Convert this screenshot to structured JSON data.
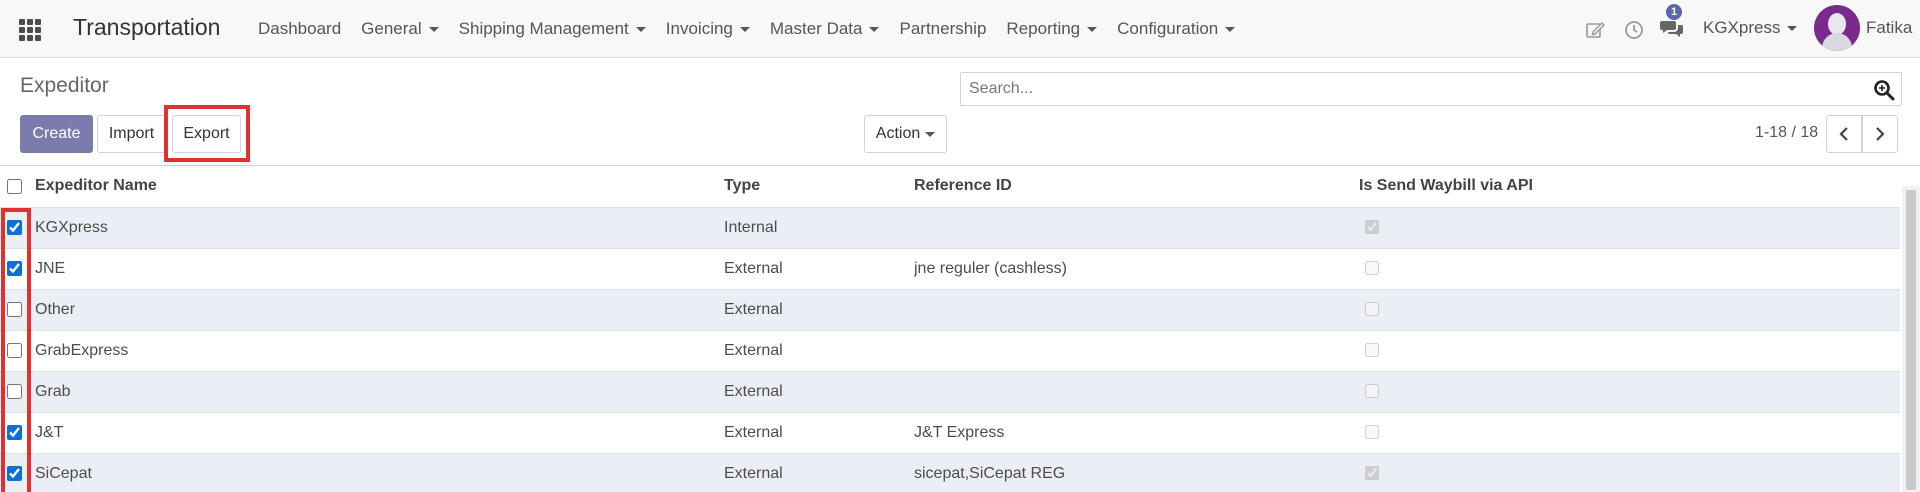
{
  "navbar": {
    "brand": "Transportation",
    "menu": [
      {
        "label": "Dashboard",
        "dropdown": false
      },
      {
        "label": "General",
        "dropdown": true
      },
      {
        "label": "Shipping Management",
        "dropdown": true
      },
      {
        "label": "Invoicing",
        "dropdown": true
      },
      {
        "label": "Master Data",
        "dropdown": true
      },
      {
        "label": "Partnership",
        "dropdown": false
      },
      {
        "label": "Reporting",
        "dropdown": true
      },
      {
        "label": "Configuration",
        "dropdown": true
      }
    ],
    "messages_badge": "1",
    "company": "KGXpress",
    "user": "Fatika"
  },
  "control_panel": {
    "title": "Expeditor",
    "create_label": "Create",
    "import_label": "Import",
    "export_label": "Export",
    "action_label": "Action",
    "search_placeholder": "Search...",
    "pager": "1-18 / 18"
  },
  "table": {
    "columns": [
      "Expeditor Name",
      "Type",
      "Reference ID",
      "Is Send Waybill via API"
    ],
    "rows": [
      {
        "name": "KGXpress",
        "type": "Internal",
        "reference": "",
        "selected": true,
        "send_api": true
      },
      {
        "name": "JNE",
        "type": "External",
        "reference": "jne reguler (cashless)",
        "selected": true,
        "send_api": false
      },
      {
        "name": "Other",
        "type": "External",
        "reference": "",
        "selected": false,
        "send_api": false
      },
      {
        "name": "GrabExpress",
        "type": "External",
        "reference": "",
        "selected": false,
        "send_api": false
      },
      {
        "name": "Grab",
        "type": "External",
        "reference": "",
        "selected": false,
        "send_api": false
      },
      {
        "name": "J&T",
        "type": "External",
        "reference": "J&T Express",
        "selected": true,
        "send_api": false
      },
      {
        "name": "SiCepat",
        "type": "External",
        "reference": "sicepat,SiCepat REG",
        "selected": true,
        "send_api": true
      }
    ]
  },
  "colors": {
    "primary": "#7c7bad",
    "highlight": "#e03030",
    "row_stripe": "#eceef6",
    "checkbox": "#0a6fd6"
  }
}
